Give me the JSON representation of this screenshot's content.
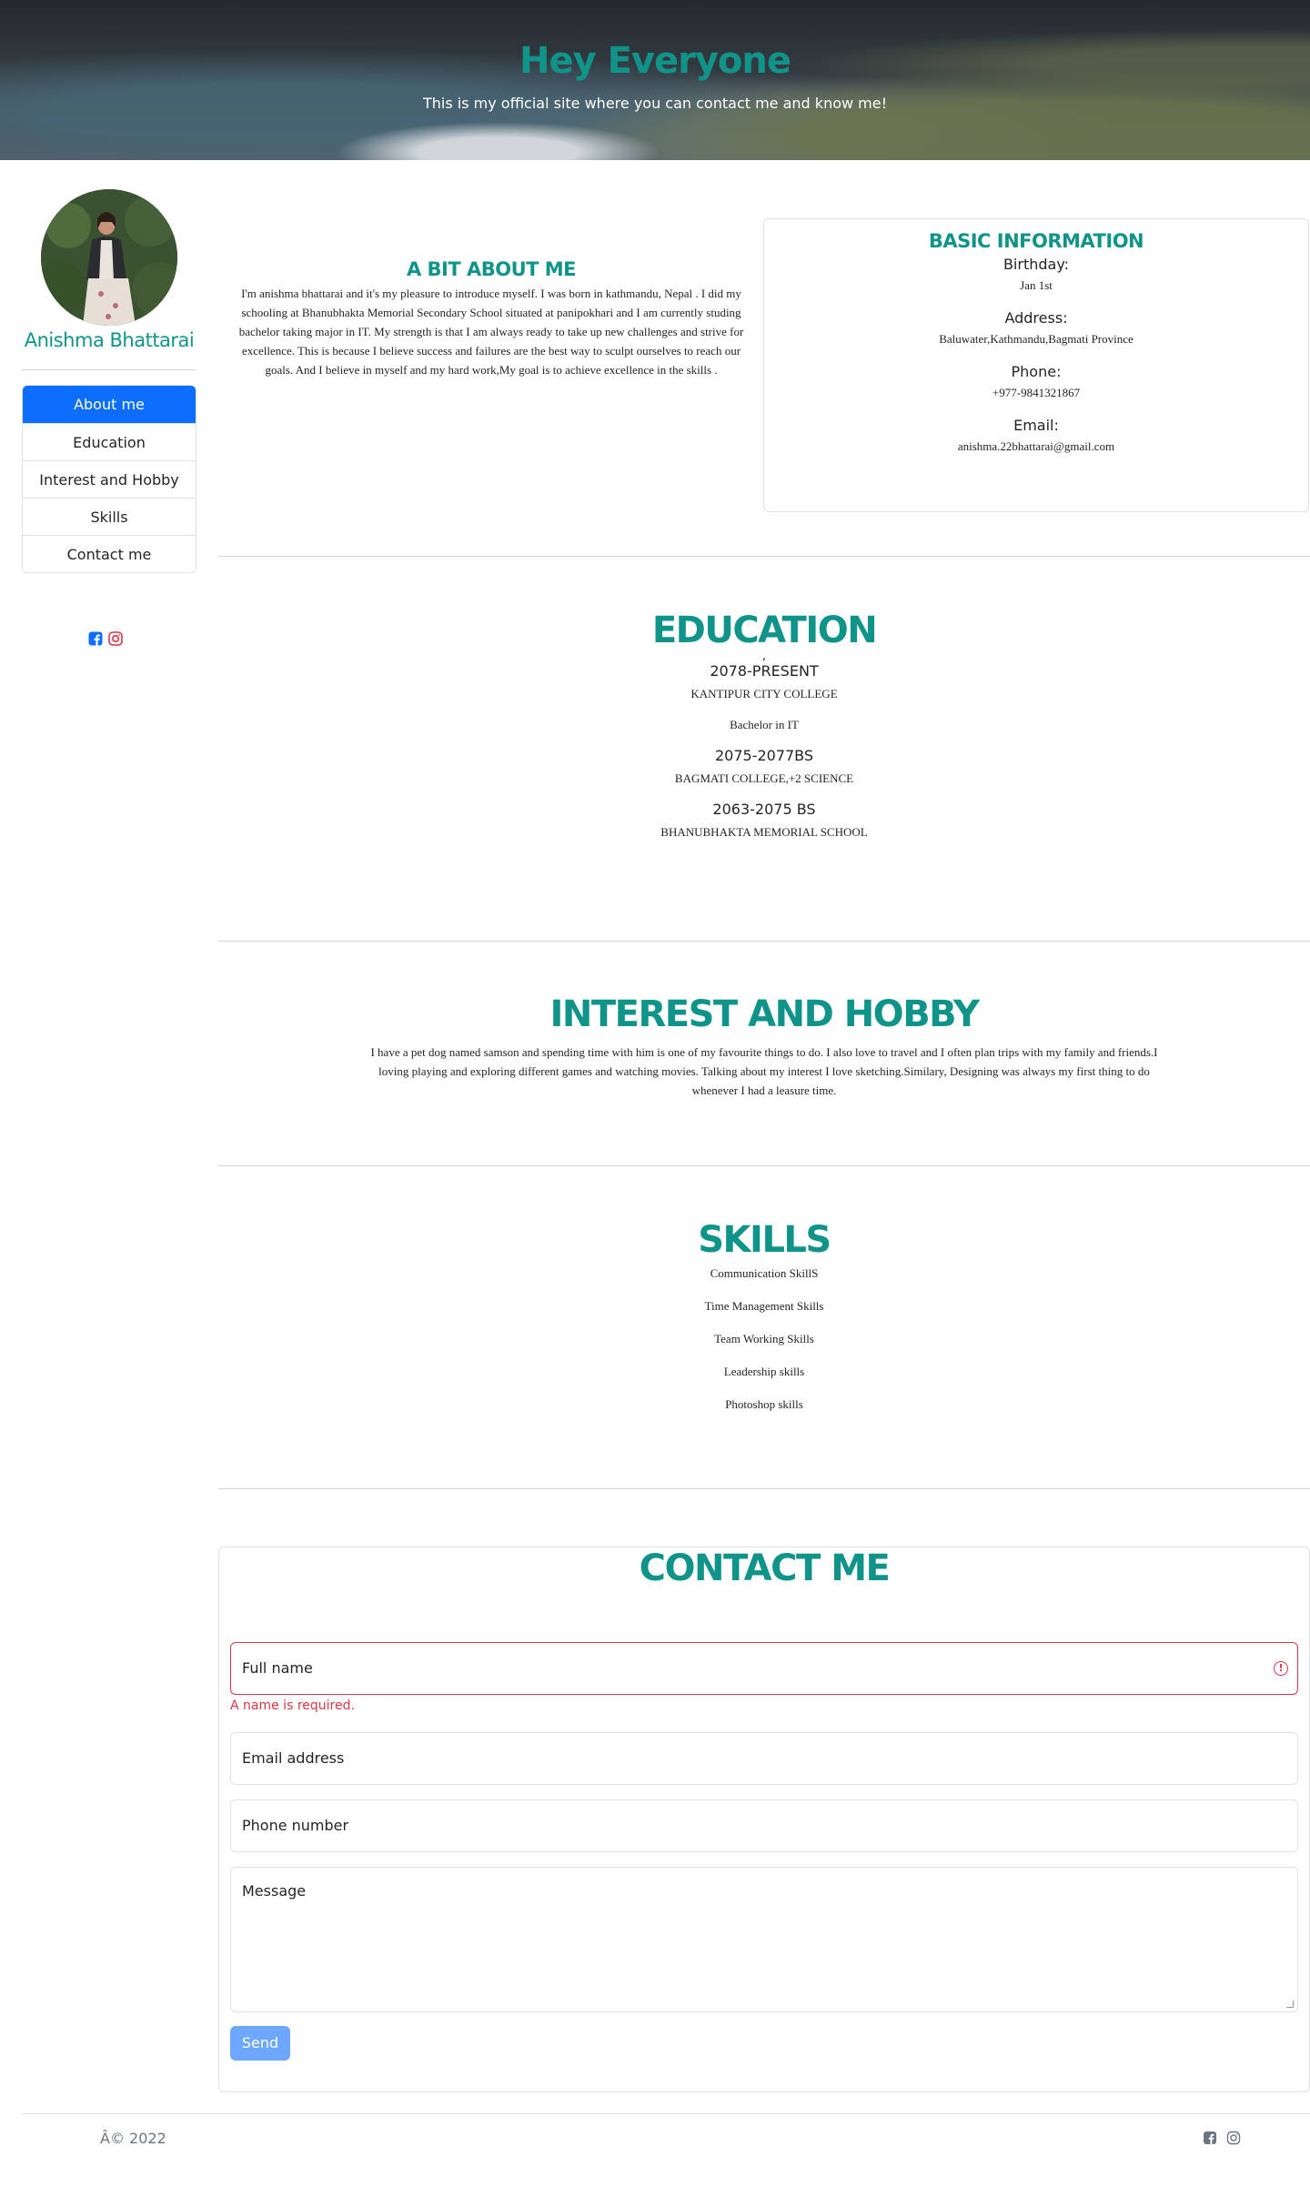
{
  "hero": {
    "title": "Hey Everyone",
    "subtitle": "This is my official site where you can contact me and know me!"
  },
  "sidebar": {
    "name": "Anishma Bhattarai",
    "nav": [
      {
        "label": "About me",
        "active": true
      },
      {
        "label": "Education",
        "active": false
      },
      {
        "label": "Interest and Hobby",
        "active": false
      },
      {
        "label": "Skills",
        "active": false
      },
      {
        "label": "Contact me",
        "active": false
      }
    ],
    "social_icons": [
      "facebook-icon",
      "instagram-icon"
    ],
    "colors": {
      "facebook": "#0d6efd",
      "instagram": "#dc3545"
    }
  },
  "about": {
    "title": "A BIT ABOUT ME",
    "text": "I'm anishma bhattarai and it's my pleasure to introduce myself. I was born in kathmandu, Nepal . I did my schooling at Bhanubhakta Memorial Secondary School situated at panipokhari and I am currently studing bachelor taking major in IT. My strength is that I am always ready to take up new challenges and strive for excellence. This is because I believe success and failures are the best way to sculpt ourselves to reach our goals. And I believe in myself and my hard work,My goal is to achieve excellence in the skills ."
  },
  "basic_info": {
    "title": "BASIC INFORMATION",
    "birthday_label": "Birthday:",
    "birthday": "Jan 1st",
    "address_label": "Address:",
    "address": "Baluwater,Kathmandu,Bagmati Province",
    "phone_label": "Phone:",
    "phone": "+977-9841321867",
    "email_label": "Email:",
    "email": "anishma.22bhattarai@gmail.com"
  },
  "education": {
    "title": "EDUCATION",
    "dot": ",",
    "year1": "2078-PRESENT",
    "school1": "KANTIPUR CITY COLLEGE",
    "degree1": "Bachelor in IT",
    "year2": "2075-2077BS",
    "school2": "BAGMATI COLLEGE,+2 SCIENCE",
    "year3": "2063-2075 BS",
    "school3": "BHANUBHAKTA MEMORIAL SCHOOL"
  },
  "interest": {
    "title": "INTEREST AND HOBBY",
    "text": "I have a pet dog named samson and spending time with him is one of my favourite things to do. I also love to travel and I often plan trips with my family and friends.I loving playing and exploring different games and watching movies. Talking about my interest I love sketching.Similary, Designing was always my first thing to do whenever I had a leasure time."
  },
  "skills": {
    "title": "SKILLS",
    "items": [
      "Communication SkillS",
      "Time Management Skills",
      "Team Working Skills",
      "Leadership skills",
      "Photoshop skills"
    ]
  },
  "contact": {
    "title": "CONTACT ME",
    "name_placeholder": "Full name",
    "name_error": "A name is required.",
    "email_placeholder": "Email address",
    "phone_placeholder": "Phone number",
    "message_placeholder": "Message",
    "send_label": "Send",
    "error_color": "#dc3545",
    "send_color": "#6ea8fe"
  },
  "footer": {
    "copyright": "Â© 2022",
    "icons": [
      "facebook-icon",
      "instagram-icon"
    ]
  },
  "theme": {
    "accent": "#10948a",
    "primary": "#0d6efd"
  }
}
